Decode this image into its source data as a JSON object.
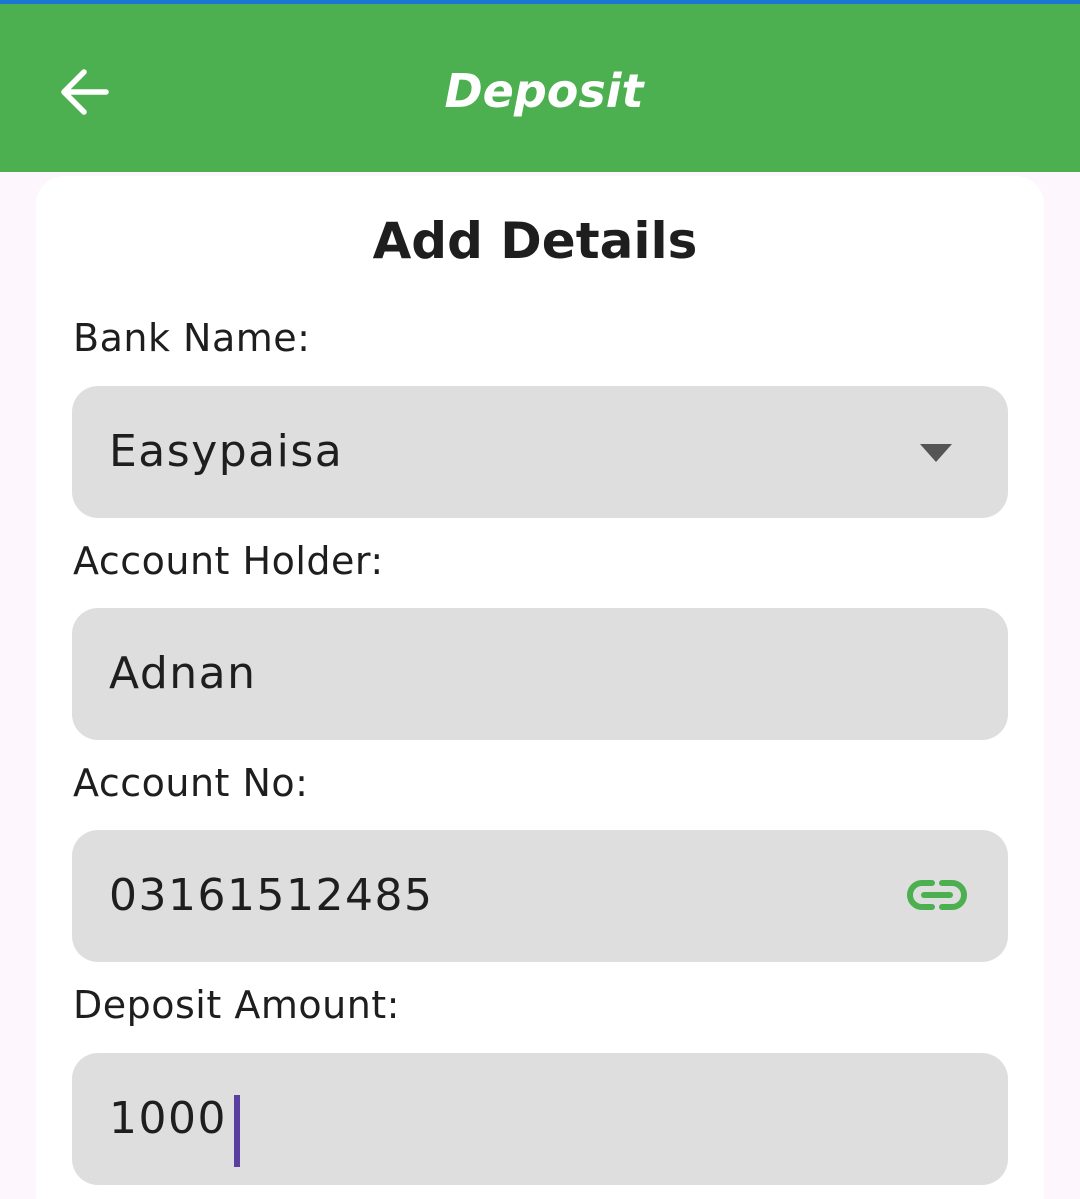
{
  "appbar": {
    "title": "Deposit",
    "back_icon": "arrow-left-icon",
    "color": "#4caf50"
  },
  "card": {
    "title": "Add Details"
  },
  "form": {
    "bank_name": {
      "label": "Bank Name:",
      "value": "Easypaisa",
      "icon": "dropdown-arrow-icon"
    },
    "account_holder": {
      "label": "Account Holder:",
      "value": "Adnan"
    },
    "account_no": {
      "label": "Account No:",
      "value": "03161512485",
      "icon": "link-icon"
    },
    "deposit_amount": {
      "label": "Deposit Amount:",
      "value": "1000"
    }
  },
  "colors": {
    "accent": "#4caf50",
    "field_bg": "#dedede",
    "cursor": "#5b3fa0"
  }
}
